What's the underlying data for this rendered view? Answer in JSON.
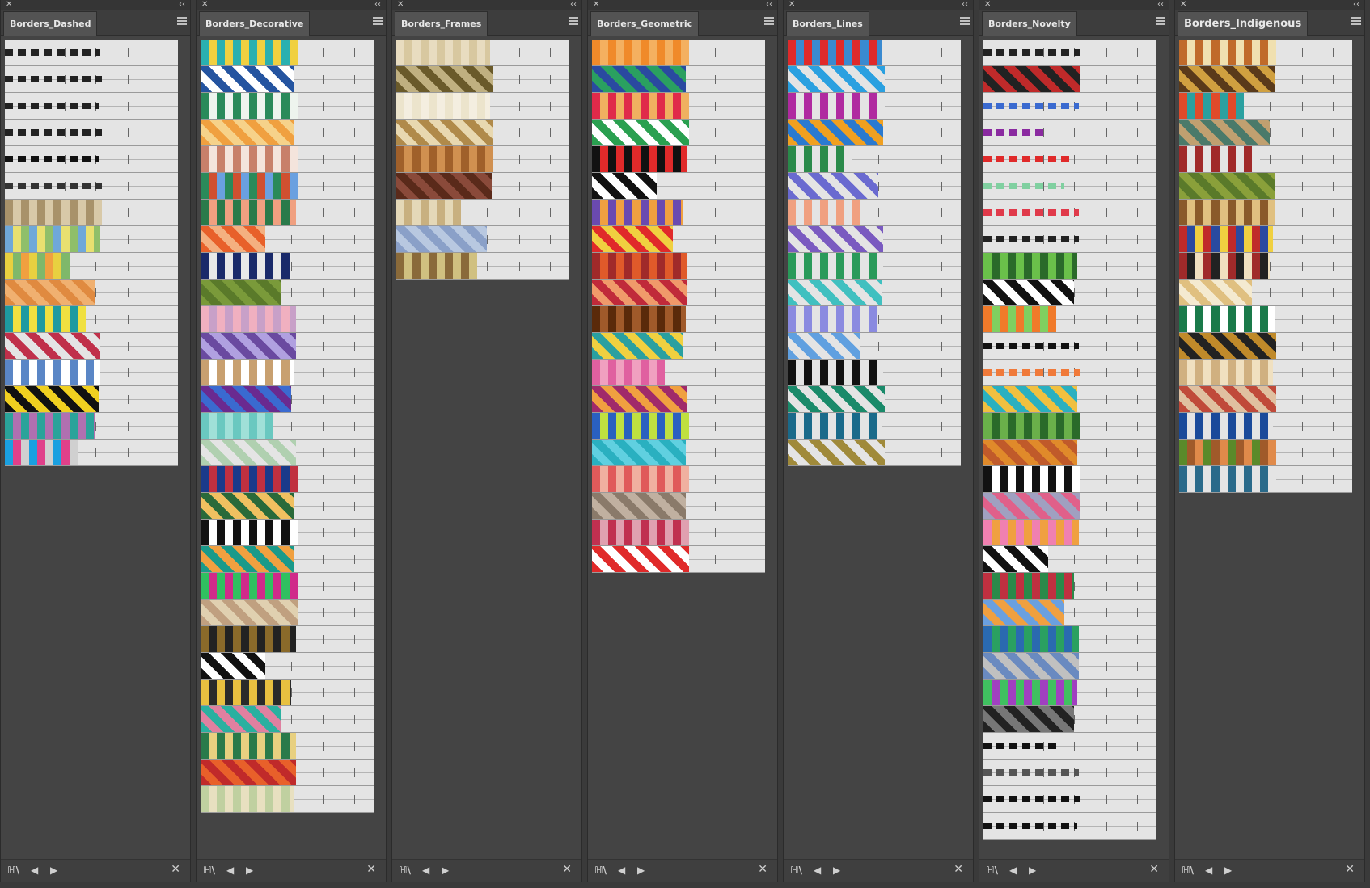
{
  "colors": {
    "panel_bg": "#444444",
    "grid_bg": "#e4e4e4",
    "tab_bg": "#535353",
    "tab_text": "#e8e8e8"
  },
  "icons": {
    "close": "✕",
    "collapse": "‹‹",
    "prev": "◀",
    "next": "▶",
    "library": "ℍ\\",
    "delete": "✕"
  },
  "panels": [
    {
      "title": "Borders_Dashed",
      "swatch_count": 16,
      "swatches": [
        [
          "#222222"
        ],
        [
          "#222222"
        ],
        [
          "#222222"
        ],
        [
          "#222222"
        ],
        [
          "#111111"
        ],
        [
          "#333333"
        ],
        [
          "#a8926a",
          "#d8c9a8"
        ],
        [
          "#6fa8d9",
          "#e8e070",
          "#8fbf6a"
        ],
        [
          "#e8d040",
          "#7fb86a",
          "#f0a040"
        ],
        [
          "#e08a40",
          "#f0b070"
        ],
        [
          "#1e9aa0",
          "#f0e040"
        ],
        [
          "#c0304a",
          "#e4e4e4"
        ],
        [
          "#5a86c6",
          "#ffffff"
        ],
        [
          "#111111",
          "#f0d020"
        ],
        [
          "#2aa39a",
          "#b070b0"
        ],
        [
          "#1aa0e0",
          "#e0408a",
          "#d0d0d0"
        ]
      ]
    },
    {
      "title": "Borders_Decorative",
      "swatch_count": 29,
      "swatches": [
        [
          "#2ab0b0",
          "#f0d040"
        ],
        [
          "#2454a0",
          "#ffffff"
        ],
        [
          "#2a8a5a",
          "#eef4ee"
        ],
        [
          "#f0a040",
          "#f6d28a"
        ],
        [
          "#c8806a",
          "#f4e4dc"
        ],
        [
          "#2a8a5a",
          "#d05030",
          "#6aa0e0"
        ],
        [
          "#2a7a4a",
          "#f0a080"
        ],
        [
          "#e8602a",
          "#f4b080"
        ],
        [
          "#1a2a6a",
          "#e8e8e8"
        ],
        [
          "#7a9a3a",
          "#5a7a2a"
        ],
        [
          "#f0b0c0",
          "#c8a0c8"
        ],
        [
          "#6a4aa0",
          "#b0a0e0"
        ],
        [
          "#c8a070",
          "#ffffff"
        ],
        [
          "#6a2a90",
          "#3a6ad0"
        ],
        [
          "#6ac8c0",
          "#a0e0d8"
        ],
        [
          "#b0d0b0",
          "#e4e4e4"
        ],
        [
          "#1a3a8a",
          "#c03040"
        ],
        [
          "#2a6a3a",
          "#f0c060"
        ],
        [
          "#111111",
          "#ffffff"
        ],
        [
          "#1a9a8a",
          "#f0a040"
        ],
        [
          "#30c060",
          "#d02a8a"
        ],
        [
          "#c0a080",
          "#e0d0b0"
        ],
        [
          "#8a6a2a",
          "#222222"
        ],
        [
          "#111111",
          "#ffffff"
        ],
        [
          "#e8c040",
          "#2a2a2a"
        ],
        [
          "#2ab0a0",
          "#e080a0"
        ],
        [
          "#2a7a4a",
          "#e8d080"
        ],
        [
          "#c02a2a",
          "#e8602a"
        ],
        [
          "#c0d0a0",
          "#e8e0c0"
        ]
      ]
    },
    {
      "title": "Borders_Frames",
      "swatch_count": 9,
      "swatches": [
        [
          "#e8dcc0",
          "#d8c8a0"
        ],
        [
          "#6a5a2a",
          "#c0b080"
        ],
        [
          "#ece4cc",
          "#f4eee0"
        ],
        [
          "#b08a4a",
          "#e8d8b0"
        ],
        [
          "#a0602a",
          "#d09050"
        ],
        [
          "#5a2a1a",
          "#8a4a3a"
        ],
        [
          "#e4d8b8",
          "#c8b080"
        ],
        [
          "#8aa0c8",
          "#b8c8e0"
        ],
        [
          "#8a6a3a",
          "#d0c080"
        ]
      ]
    },
    {
      "title": "Borders_Geometric",
      "swatch_count": 20,
      "swatches": [
        [
          "#f08a2a",
          "#f4b060"
        ],
        [
          "#2a4aa0",
          "#2aa060"
        ],
        [
          "#e02a4a",
          "#f0b060"
        ],
        [
          "#2aa050",
          "#ffffff"
        ],
        [
          "#111111",
          "#e02a2a"
        ],
        [
          "#111111",
          "#ffffff"
        ],
        [
          "#6a4ab0",
          "#f0a040"
        ],
        [
          "#e02a2a",
          "#f0d040"
        ],
        [
          "#a02a2a",
          "#e05a2a"
        ],
        [
          "#c02a3a",
          "#f09a6a"
        ],
        [
          "#5a2a0a",
          "#a05a2a"
        ],
        [
          "#2aa0a0",
          "#f0d040"
        ],
        [
          "#e060a0",
          "#f0a0c0"
        ],
        [
          "#a02a6a",
          "#f0a040"
        ],
        [
          "#2a60c0",
          "#c0e040"
        ],
        [
          "#2ab0c0",
          "#60d0e0"
        ],
        [
          "#e05a5a",
          "#f0b0a0"
        ],
        [
          "#8a7a6a",
          "#c0b0a0"
        ],
        [
          "#c03050",
          "#e0a0b0"
        ],
        [
          "#e02a2a",
          "#ffffff"
        ]
      ]
    },
    {
      "title": "Borders_Lines",
      "swatch_count": 16,
      "swatches": [
        [
          "#e02a2a",
          "#3a8ad0"
        ],
        [
          "#2aa0e0",
          "#e4e4e4"
        ],
        [
          "#b02aa0",
          "#e4e4e4"
        ],
        [
          "#f0a020",
          "#2a7ad0"
        ],
        [
          "#2a8a4a",
          "#e4e4e4"
        ],
        [
          "#6a6ad0",
          "#e4e4e4"
        ],
        [
          "#f0a080",
          "#e4e4e4"
        ],
        [
          "#7a5ac0",
          "#e4e4e4"
        ],
        [
          "#2a9a5a",
          "#e4e4e4"
        ],
        [
          "#40c0c0",
          "#e4e4e4"
        ],
        [
          "#8a8ae0",
          "#e4e4e4"
        ],
        [
          "#60a0e0",
          "#e4e4e4"
        ],
        [
          "#111111",
          "#e4e4e4"
        ],
        [
          "#1a8a6a",
          "#e4e4e4"
        ],
        [
          "#1a6a8a",
          "#e4e4e4"
        ],
        [
          "#a08a3a",
          "#e4e4e4"
        ]
      ]
    },
    {
      "title": "Borders_Novelty",
      "swatch_count": 30,
      "swatches": [
        [
          "#222222"
        ],
        [
          "#c02a2a",
          "#222222"
        ],
        [
          "#3a6ad0"
        ],
        [
          "#8a2aa0"
        ],
        [
          "#e02a2a"
        ],
        [
          "#80d0a0"
        ],
        [
          "#e03a4a"
        ],
        [
          "#222222"
        ],
        [
          "#6ac04a",
          "#2a6a2a"
        ],
        [
          "#111111",
          "#ffffff"
        ],
        [
          "#f07a2a",
          "#80d060"
        ],
        [
          "#111111"
        ],
        [
          "#f07a3a"
        ],
        [
          "#f0c040",
          "#2ab0c0"
        ],
        [
          "#6ab04a",
          "#2a6a2a"
        ],
        [
          "#e08a2a",
          "#c05a2a"
        ],
        [
          "#111111",
          "#ffffff"
        ],
        [
          "#a0a0c0",
          "#e0608a"
        ],
        [
          "#f080b0",
          "#f0a040"
        ],
        [
          "#111111",
          "#ffffff"
        ],
        [
          "#c03040",
          "#2a8a4a"
        ],
        [
          "#6aa0e0",
          "#f0a040"
        ],
        [
          "#2a6ab0",
          "#2aa060"
        ],
        [
          "#6a8ac0",
          "#c0c0c0"
        ],
        [
          "#40c060",
          "#a040c0"
        ],
        [
          "#222222",
          "#777777"
        ],
        [
          "#111111"
        ],
        [
          "#555555"
        ],
        [
          "#111111"
        ],
        [
          "#111111"
        ]
      ]
    },
    {
      "title": "Borders_Indigenous",
      "swatch_count": 17,
      "swatches": [
        [
          "#c06a2a",
          "#f0e0b0"
        ],
        [
          "#5a3a1a",
          "#d0a040"
        ],
        [
          "#e04a2a",
          "#2aa0a0"
        ],
        [
          "#4a7a6a",
          "#c0a070"
        ],
        [
          "#a02a2a",
          "#e4e4e4"
        ],
        [
          "#8aa03a",
          "#5a7a2a"
        ],
        [
          "#8a5a2a",
          "#e0c080"
        ],
        [
          "#c02a2a",
          "#2a4aa0",
          "#f0d040"
        ],
        [
          "#a02a2a",
          "#222222",
          "#f0e0c0"
        ],
        [
          "#e0c080",
          "#f4ead0"
        ],
        [
          "#1a7a4a",
          "#ffffff"
        ],
        [
          "#c08a2a",
          "#222222"
        ],
        [
          "#d0b080",
          "#f0e0c0"
        ],
        [
          "#c04a3a",
          "#e0c0a0"
        ],
        [
          "#1a4a9a",
          "#e4e4e4"
        ],
        [
          "#5a8a2a",
          "#a05a2a",
          "#e08a4a"
        ],
        [
          "#2a6a8a",
          "#e4e4e4"
        ]
      ]
    }
  ]
}
